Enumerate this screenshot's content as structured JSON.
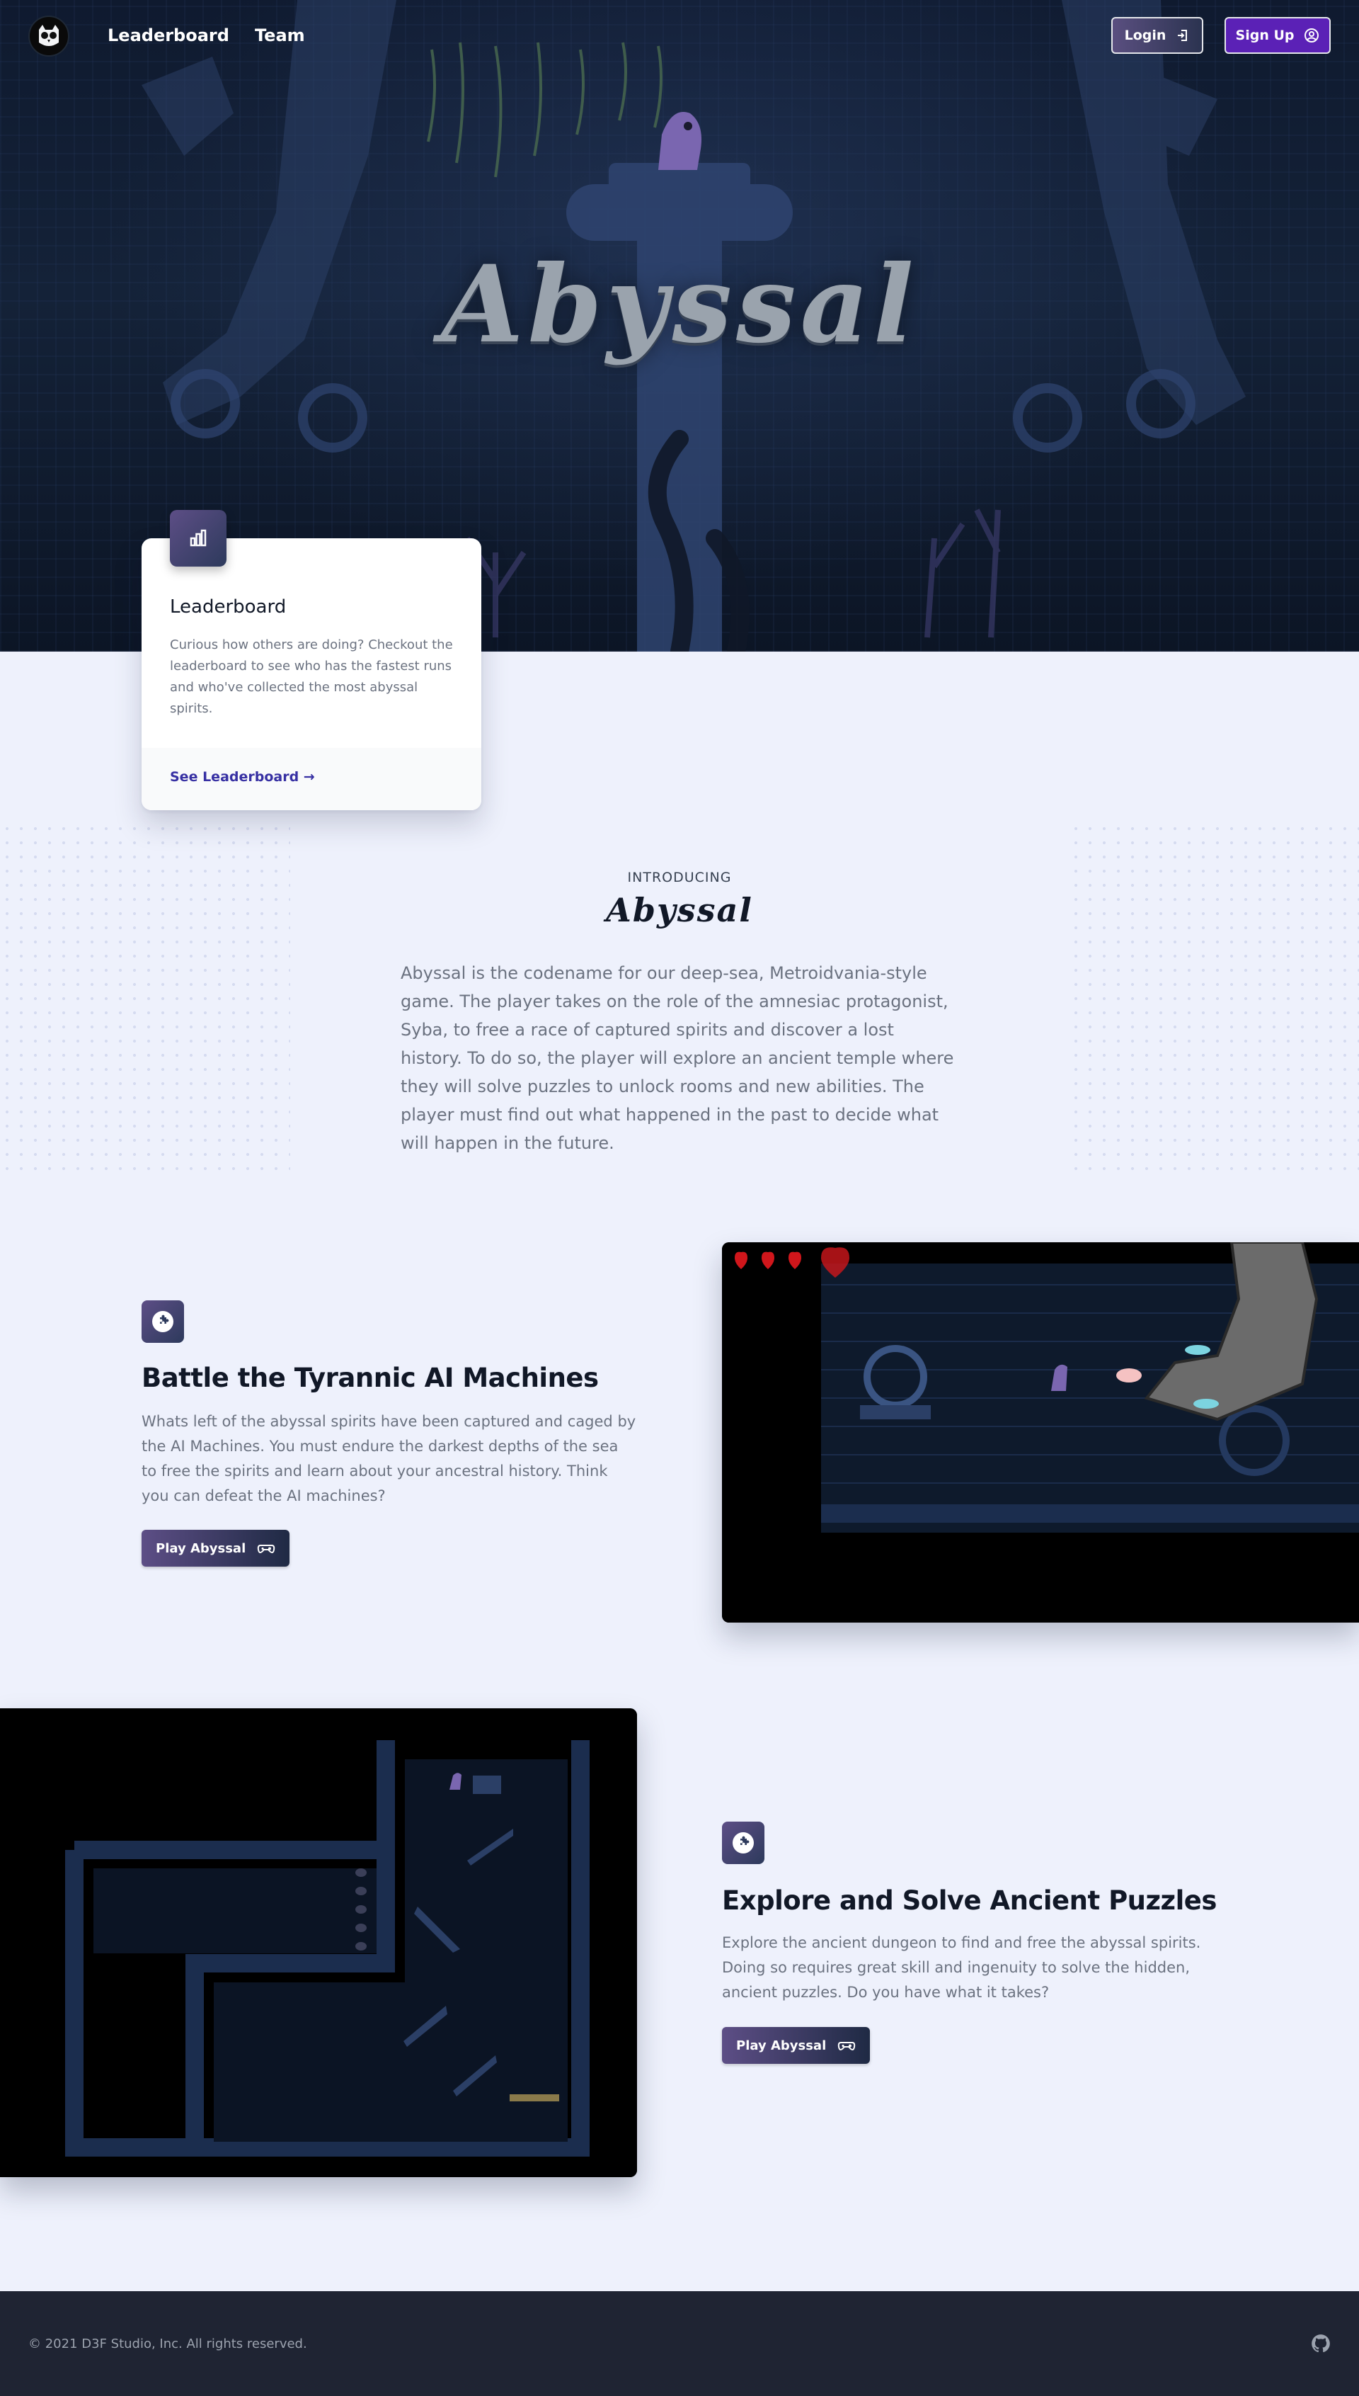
{
  "nav": {
    "links": [
      "Leaderboard",
      "Team"
    ],
    "login_label": "Login",
    "signup_label": "Sign Up"
  },
  "hero": {
    "title": "Abyssal"
  },
  "leaderboard_card": {
    "title": "Leaderboard",
    "text": "Curious how others are doing? Checkout the leaderboard to see who has the fastest runs and who've collected the most abyssal spirits.",
    "link": "See Leaderboard →"
  },
  "intro": {
    "kicker": "INTRODUCING",
    "logo": "Abyssal",
    "text": "Abyssal is the codename for our deep-sea, Metroidvania-style game. The player takes on the role of the amnesiac protagonist, Syba, to free a race of captured spirits and discover a lost history. To do so, the player will explore an ancient temple where they will solve puzzles to unlock rooms and new abilities. The player must find out what happened in the past to decide what will happen in the future."
  },
  "features": [
    {
      "title": "Battle the Tyrannic AI Machines",
      "text": "Whats left of the abyssal spirits have been captured and caged by the AI Machines. You must endure the darkest depths of the sea to free the spirits and learn about your ancestral history. Think you can defeat the AI machines?",
      "button": "Play Abyssal"
    },
    {
      "title": "Explore and Solve Ancient Puzzles",
      "text": "Explore the ancient dungeon to find and free the abyssal spirits. Doing so requires great skill and ingenuity to solve the hidden, ancient puzzles. Do you have what it takes?",
      "button": "Play Abyssal"
    }
  ],
  "footer": {
    "copyright": "© 2021 D3F Studio, Inc. All rights reserved."
  },
  "colors": {
    "page_bg": "#eef1fc",
    "hero_bg": "#142238",
    "accent_purple": "#5b21b6",
    "icon_gradient_start": "#5d4e86",
    "icon_gradient_end": "#2d3a5c",
    "link_blue": "#3730a3",
    "footer_bg": "#1f2433"
  },
  "icons": {
    "logo": "owl-logo-icon",
    "login": "sign-in-icon",
    "signup": "user-circle-icon",
    "leaderboard": "bar-chart-icon",
    "feature": "puzzle-icon",
    "play": "gamepad-icon",
    "footer": "github-icon"
  }
}
